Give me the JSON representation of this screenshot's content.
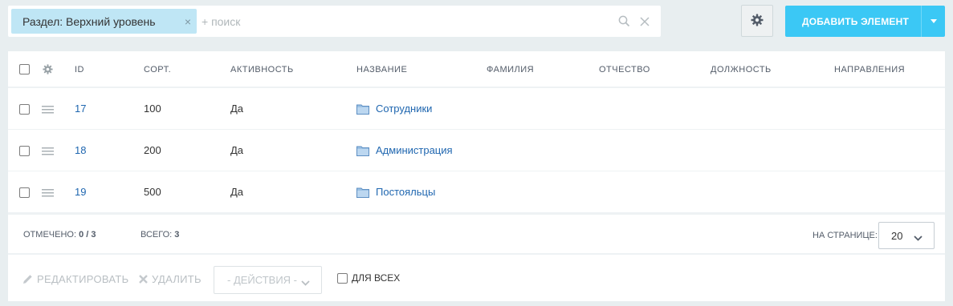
{
  "filter": {
    "chip_label": "Раздел: Верхний уровень",
    "chip_remove": "×",
    "search_placeholder": "+ поиск"
  },
  "toolbar": {
    "add_label": "ДОБАВИТЬ ЭЛЕМЕНТ"
  },
  "grid": {
    "columns": [
      "ID",
      "СОРТ.",
      "АКТИВНОСТЬ",
      "НАЗВАНИЕ",
      "ФАМИЛИЯ",
      "ОТЧЕСТВО",
      "ДОЛЖНОСТЬ",
      "НАПРАВЛЕНИЯ"
    ],
    "rows": [
      {
        "id": "17",
        "sort": "100",
        "active": "Да",
        "name": "Сотрудники"
      },
      {
        "id": "18",
        "sort": "200",
        "active": "Да",
        "name": "Администрация"
      },
      {
        "id": "19",
        "sort": "500",
        "active": "Да",
        "name": "Постояльцы"
      }
    ]
  },
  "footer": {
    "selected_label": "ОТМЕЧЕНО:",
    "selected_value": "0 / 3",
    "total_label": "ВСЕГО:",
    "total_value": "3",
    "per_page_label": "НА СТРАНИЦЕ:",
    "per_page_value": "20"
  },
  "actions": {
    "edit_label": "РЕДАКТИРОВАТЬ",
    "delete_label": "УДАЛИТЬ",
    "select_label": "- ДЕЙСТВИЯ -",
    "for_all_label": "ДЛЯ ВСЕХ"
  },
  "colors": {
    "accent": "#3bc8f5",
    "chip": "#bfe6f5",
    "link": "#2067b0",
    "background": "#e8eef0"
  }
}
